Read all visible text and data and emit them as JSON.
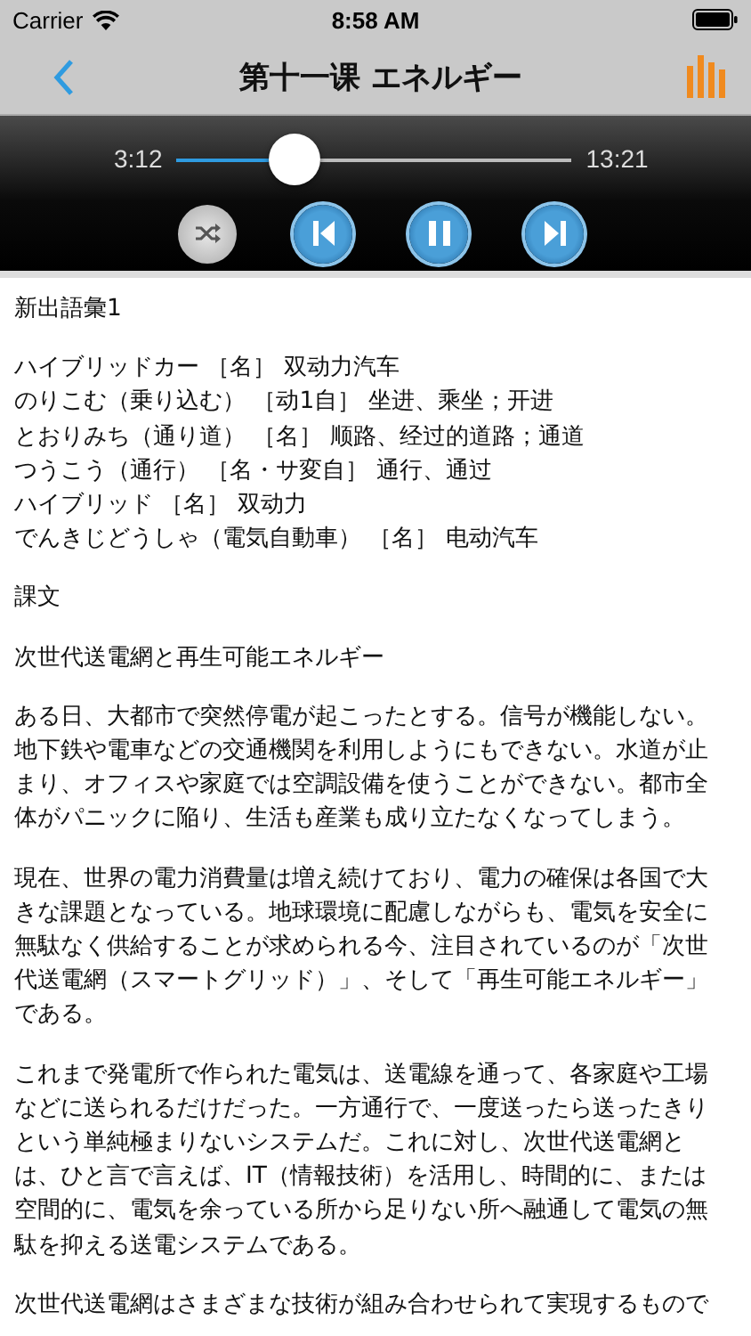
{
  "status_bar": {
    "carrier": "Carrier",
    "time": "8:58 AM"
  },
  "nav": {
    "title": "第十一课 エネルギー"
  },
  "player": {
    "elapsed": "3:12",
    "total": "13:21",
    "level": 0.27,
    "shuffle_on": false,
    "playing": true
  },
  "content": [
    {
      "kind": "heading",
      "text": "新出語彙1"
    },
    {
      "kind": "vocab",
      "lines": [
        "ハイブリッドカー ［名］ 双动力汽车",
        "のりこむ（乗り込む） ［动1自］ 坐进、乘坐；开进",
        "とおりみち（通り道） ［名］ 顺路、经过的道路；通道",
        "つうこう（通行） ［名・サ変自］ 通行、通过",
        "ハイブリッド ［名］ 双动力",
        "でんきじどうしゃ（電気自動車） ［名］ 电动汽车"
      ]
    },
    {
      "kind": "heading",
      "text": "課文"
    },
    {
      "kind": "heading",
      "text": "次世代送電網と再生可能エネルギー"
    },
    {
      "kind": "paragraph",
      "text": "ある日、大都市で突然停電が起こったとする。信号が機能しない。地下鉄や電車などの交通機関を利用しようにもできない。水道が止まり、オフィスや家庭では空調設備を使うことができない。都市全体がパニックに陥り、生活も産業も成り立たなくなってしまう。"
    },
    {
      "kind": "paragraph",
      "text": "現在、世界の電力消費量は増え続けており、電力の確保は各国で大きな課題となっている。地球環境に配慮しながらも、電気を安全に無駄なく供給することが求められる今、注目されているのが「次世代送電網（スマートグリッド）」、そして「再生可能エネルギー」である。"
    },
    {
      "kind": "paragraph",
      "text": "これまで発電所で作られた電気は、送電線を通って、各家庭や工場などに送られるだけだった。一方通行で、一度送ったら送ったきりという単純極まりないシステムだ。これに対し、次世代送電網とは、ひと言で言えば、IT（情報技術）を活用し、時間的に、または空間的に、電気を余っている所から足りない所へ融通して電気の無駄を抑える送電システムである。"
    },
    {
      "kind": "paragraph",
      "text": "次世代送電網はさまざまな技術が組み合わせられて実現するもので"
    }
  ]
}
